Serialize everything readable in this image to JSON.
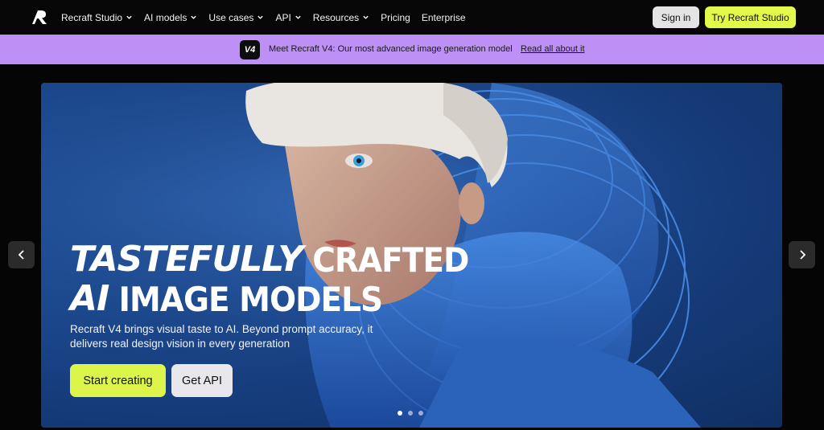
{
  "nav": {
    "logo_icon": "recraft-logo-icon",
    "items": [
      {
        "label": "Recraft Studio",
        "has_dropdown": true
      },
      {
        "label": "AI models",
        "has_dropdown": true
      },
      {
        "label": "Use cases",
        "has_dropdown": true
      },
      {
        "label": "API",
        "has_dropdown": true
      },
      {
        "label": "Resources",
        "has_dropdown": true
      },
      {
        "label": "Pricing",
        "has_dropdown": false
      },
      {
        "label": "Enterprise",
        "has_dropdown": false
      }
    ],
    "sign_in": "Sign in",
    "try_button": "Try Recraft Studio"
  },
  "banner": {
    "badge": "V4",
    "text": "Meet Recraft V4: Our most advanced image generation model",
    "link": "Read all about it"
  },
  "hero": {
    "headline_line1_italic": "TASTEFULLY",
    "headline_line1_normal": "CRAFTED",
    "headline_line2_italic": "AI",
    "headline_line2_normal": "IMAGE MODELS",
    "subtitle": "Recraft V4 brings visual taste to AI. Beyond prompt accuracy, it delivers real design vision in every generation",
    "primary_cta": "Start creating",
    "secondary_cta": "Get API",
    "slides_total": 3,
    "slide_active": 1
  },
  "colors": {
    "accent_lime": "#dcf54a",
    "banner_purple": "#bd90f5",
    "hero_blue": "#1d4a91"
  }
}
